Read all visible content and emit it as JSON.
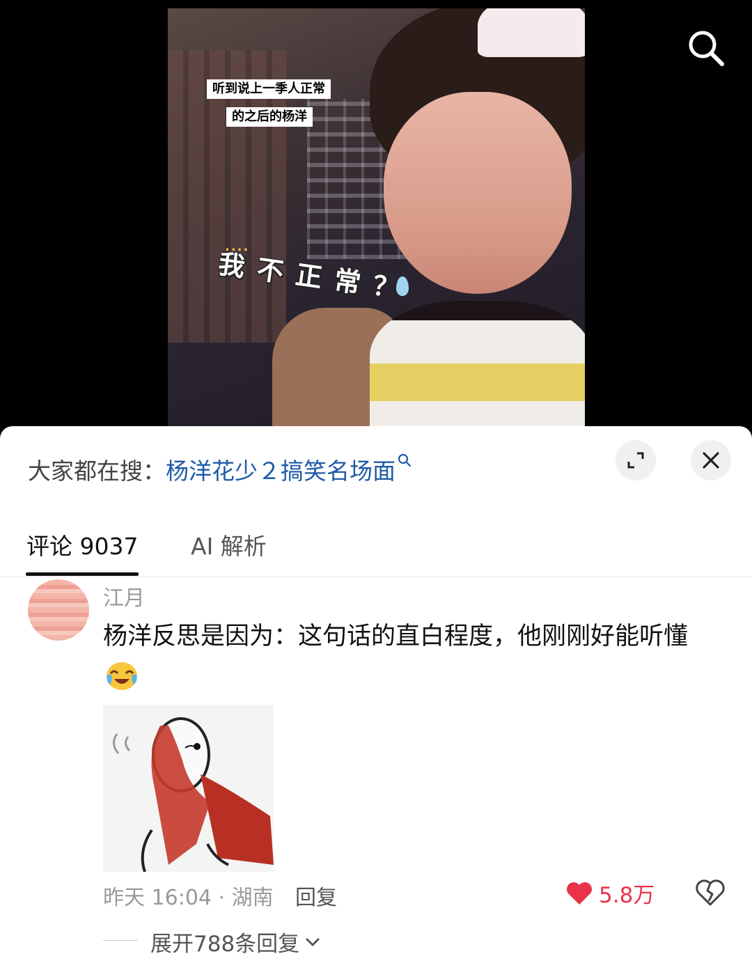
{
  "video": {
    "caption_line1": "听到说上一季人正常",
    "caption_line2": "的之后的杨洋",
    "sticker_dots": "....",
    "sticker_text": "我不正常？"
  },
  "hot_search": {
    "prefix": "大家都在搜：",
    "term": "杨洋花少２搞笑名场面"
  },
  "tabs": [
    {
      "label": "评论 9037",
      "active": true
    },
    {
      "label": "AI 解析",
      "active": false
    }
  ],
  "comment": {
    "username": "江月",
    "text": "杨洋反思是因为：这句话的直白程度，他刚刚好能听懂",
    "emoji": "crying-laughing-emoji",
    "meta": "昨天 16:04 · 湖南",
    "reply_label": "回复",
    "like_count": "5.8万",
    "expand_replies": "展开788条回复"
  },
  "colors": {
    "accent_blue": "#1e5aa8",
    "like_red": "#e8334a",
    "sheet_bg": "#ffffff",
    "video_bg": "#000000"
  },
  "icons": [
    "search-icon",
    "expand-icon",
    "close-icon",
    "heart-icon",
    "broken-heart-icon",
    "chevron-down-icon"
  ]
}
